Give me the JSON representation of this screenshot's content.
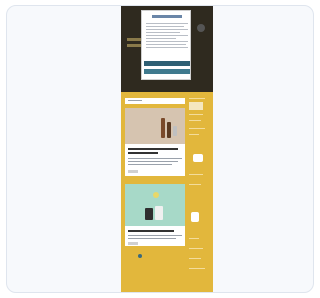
{
  "screenshot": {
    "preview_alt": ""
  },
  "consent": {
    "accept_label": "",
    "manage_label": ""
  }
}
